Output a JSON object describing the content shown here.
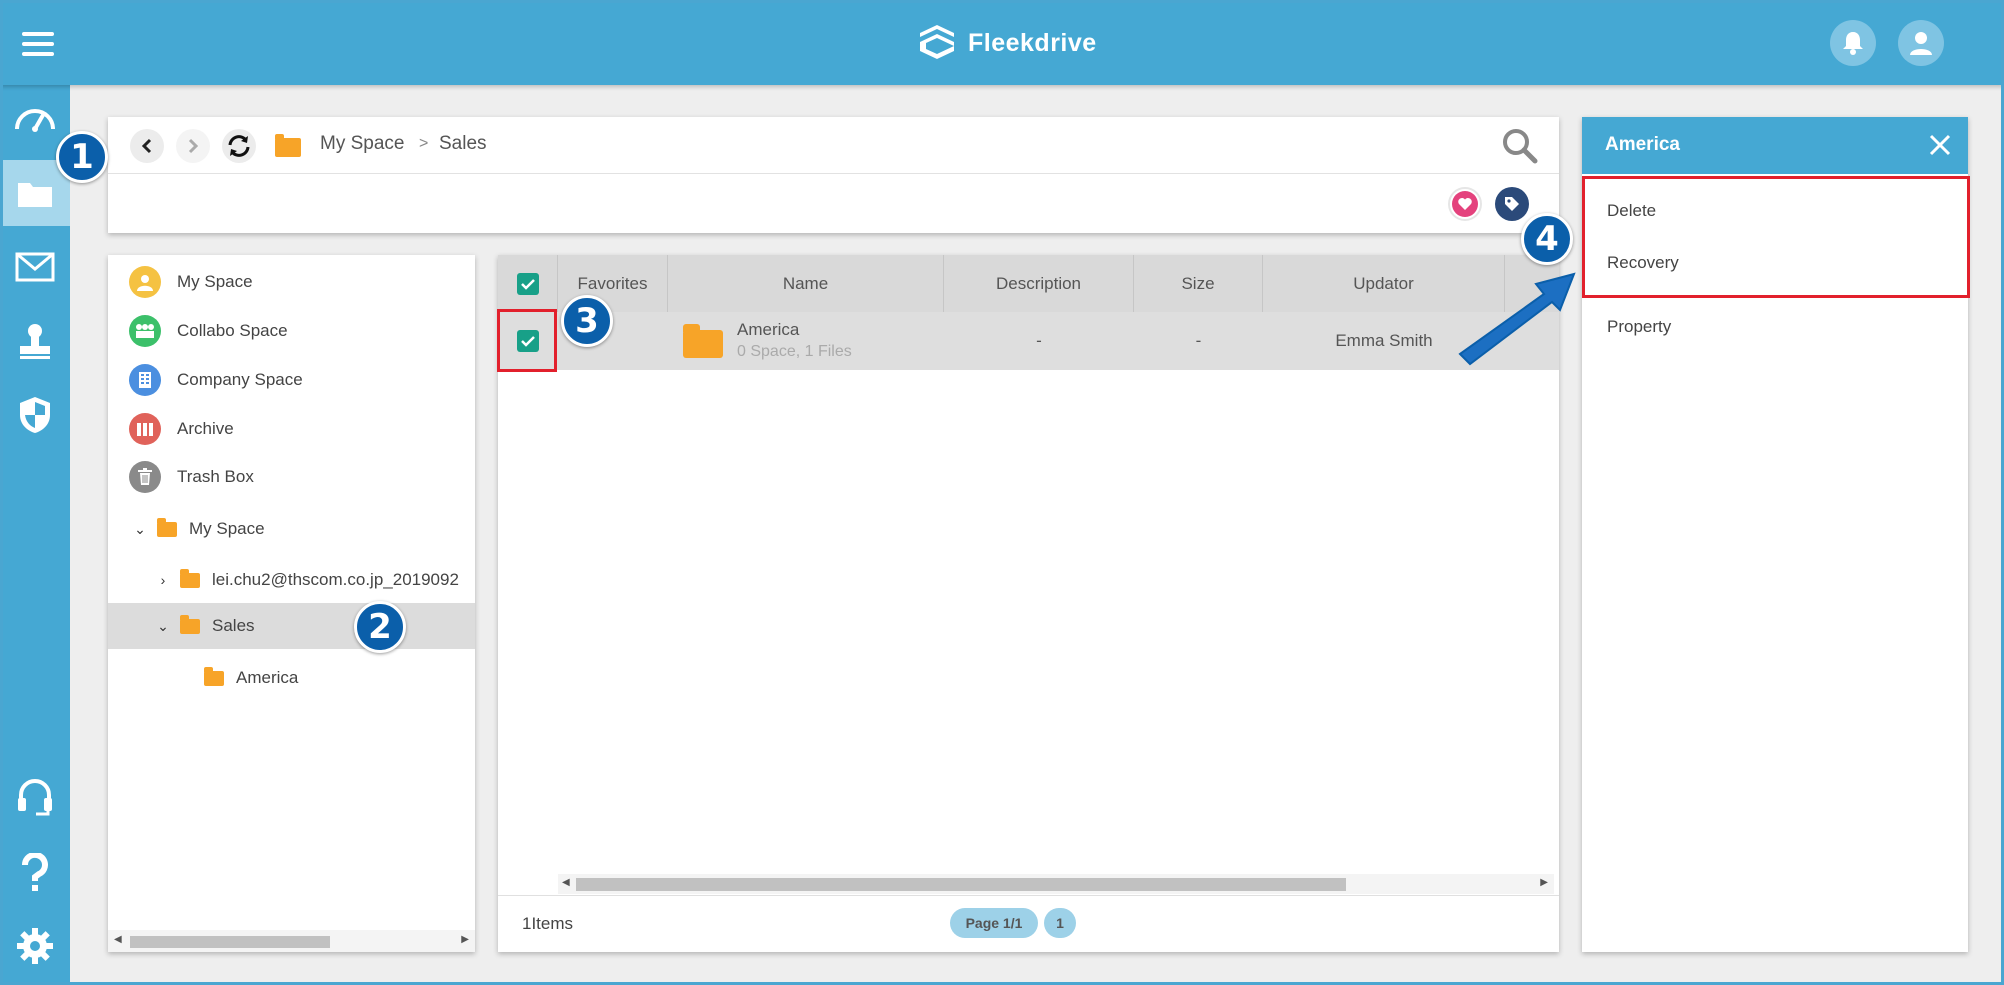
{
  "app": {
    "brand": "Fleekdrive"
  },
  "toolbar": {
    "breadcrumb": [
      "My Space",
      "Sales"
    ],
    "separator": ">"
  },
  "tree": {
    "spaces": [
      {
        "label": "My Space",
        "icon": "person-icon",
        "color": "#f5c242"
      },
      {
        "label": "Collabo Space",
        "icon": "group-icon",
        "color": "#3cc06a"
      },
      {
        "label": "Company Space",
        "icon": "building-icon",
        "color": "#4b8fe0"
      },
      {
        "label": "Archive",
        "icon": "archive-icon",
        "color": "#e0625a"
      },
      {
        "label": "Trash Box",
        "icon": "trash-icon",
        "color": "#8a8a8a"
      }
    ],
    "folders": [
      {
        "label": "My Space",
        "expander": "⌄"
      },
      {
        "label": "lei.chu2@thscom.co.jp_2019092",
        "expander": ">"
      },
      {
        "label": "Sales",
        "expander": "⌄"
      },
      {
        "label": "America",
        "expander": ""
      }
    ]
  },
  "grid": {
    "columns": [
      "Favorites",
      "Name",
      "Description",
      "Size",
      "Updator"
    ],
    "rows": [
      {
        "name": "America",
        "sub": "0 Space, 1 Files",
        "description": "-",
        "size": "-",
        "updator": "Emma Smith",
        "checked": true
      }
    ],
    "item_count": "1Items",
    "page_label": "Page 1/1",
    "page_number": "1"
  },
  "context_panel": {
    "title": "America",
    "actions": [
      "Delete",
      "Recovery",
      "Property"
    ]
  },
  "markers": [
    "1",
    "2",
    "3",
    "4"
  ],
  "colors": {
    "primary": "#45a8d3",
    "check": "#18a088",
    "folder": "#f7a428",
    "highlight": "#e2202c",
    "marker": "#0b5faa"
  }
}
